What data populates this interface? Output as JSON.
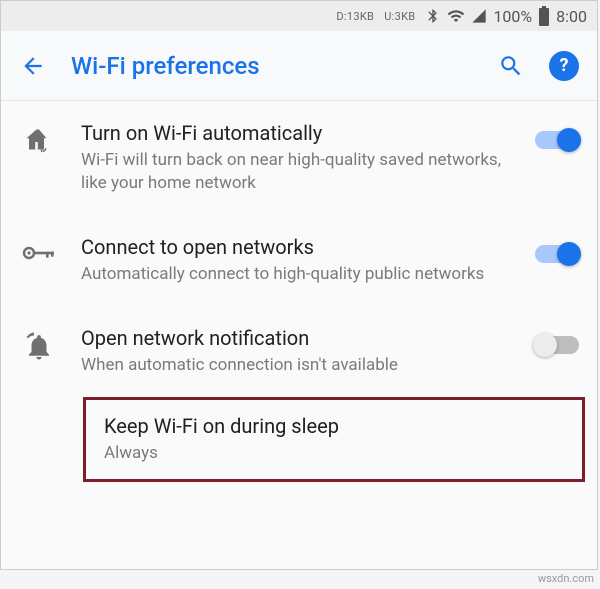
{
  "status_bar": {
    "net_down": "D:13KB",
    "net_up": "U:3KB",
    "battery_pct": "100%",
    "time": "8:00"
  },
  "app_bar": {
    "title": "Wi-Fi preferences"
  },
  "settings": {
    "auto_wifi": {
      "title": "Turn on Wi-Fi automatically",
      "sub": "Wi-Fi will turn back on near high-quality saved networks, like your home network",
      "on": true
    },
    "open_networks": {
      "title": "Connect to open networks",
      "sub": "Automatically connect to high-quality public networks",
      "on": true
    },
    "open_notify": {
      "title": "Open network notification",
      "sub": "When automatic connection isn't available",
      "on": false
    },
    "keep_sleep": {
      "title": "Keep Wi-Fi on during sleep",
      "sub": "Always"
    }
  },
  "watermark": "wsxdn.com"
}
